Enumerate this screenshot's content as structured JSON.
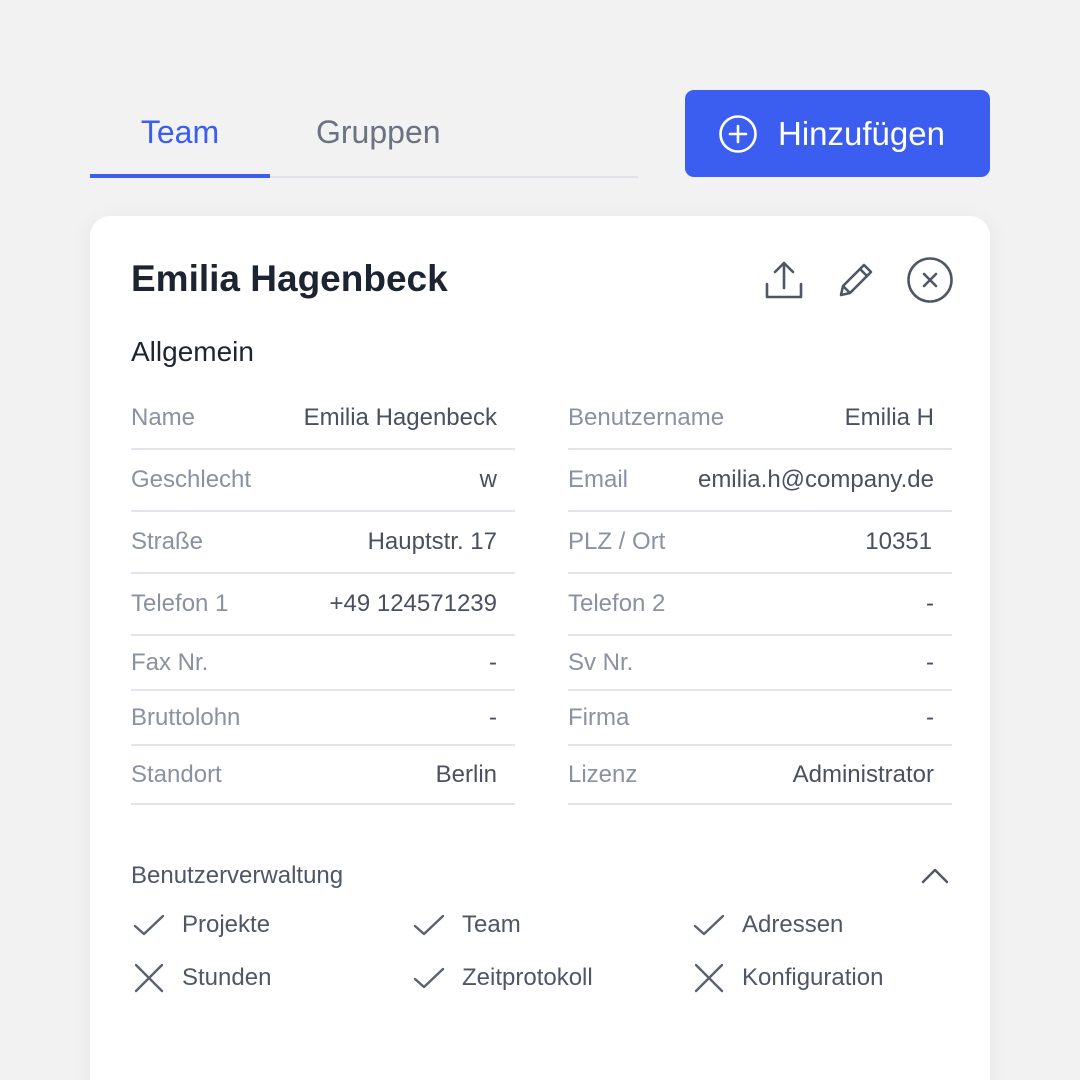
{
  "tabs": [
    {
      "label": "Team",
      "active": true
    },
    {
      "label": "Gruppen",
      "active": false
    }
  ],
  "add_button": {
    "label": "Hinzufügen",
    "icon": "plus-circle-icon"
  },
  "accent_color": "#3c5ef0",
  "card": {
    "title": "Emilia Hagenbeck",
    "actions": [
      "upload-icon",
      "pencil-icon",
      "close-circle-icon"
    ],
    "section": "Allgemein",
    "left_fields": [
      {
        "label": "Name",
        "value": "Emilia Hagenbeck"
      },
      {
        "label": "Geschlecht",
        "value": "w"
      },
      {
        "label": "Straße",
        "value": "Hauptstr. 17"
      },
      {
        "label": "Telefon 1",
        "value": "+49 124571239"
      },
      {
        "label": "Fax Nr.",
        "value": "-"
      },
      {
        "label": "Bruttolohn",
        "value": "-"
      },
      {
        "label": "Standort",
        "value": "Berlin"
      }
    ],
    "right_fields": [
      {
        "label": "Benutzername",
        "value": "Emilia H"
      },
      {
        "label": "Email",
        "value": "emilia.h@company.de"
      },
      {
        "label": "PLZ / Ort",
        "value": "10351"
      },
      {
        "label": "Telefon 2",
        "value": "-"
      },
      {
        "label": "Sv Nr.",
        "value": "-"
      },
      {
        "label": "Firma",
        "value": "-"
      },
      {
        "label": "Lizenz",
        "value": "Administrator"
      }
    ],
    "permissions_title": "Benutzerverwaltung",
    "permissions": [
      {
        "label": "Projekte",
        "granted": true
      },
      {
        "label": "Team",
        "granted": true
      },
      {
        "label": "Adressen",
        "granted": true
      },
      {
        "label": "Stunden",
        "granted": false
      },
      {
        "label": "Zeitprotokoll",
        "granted": true
      },
      {
        "label": "Konfiguration",
        "granted": false
      }
    ]
  }
}
